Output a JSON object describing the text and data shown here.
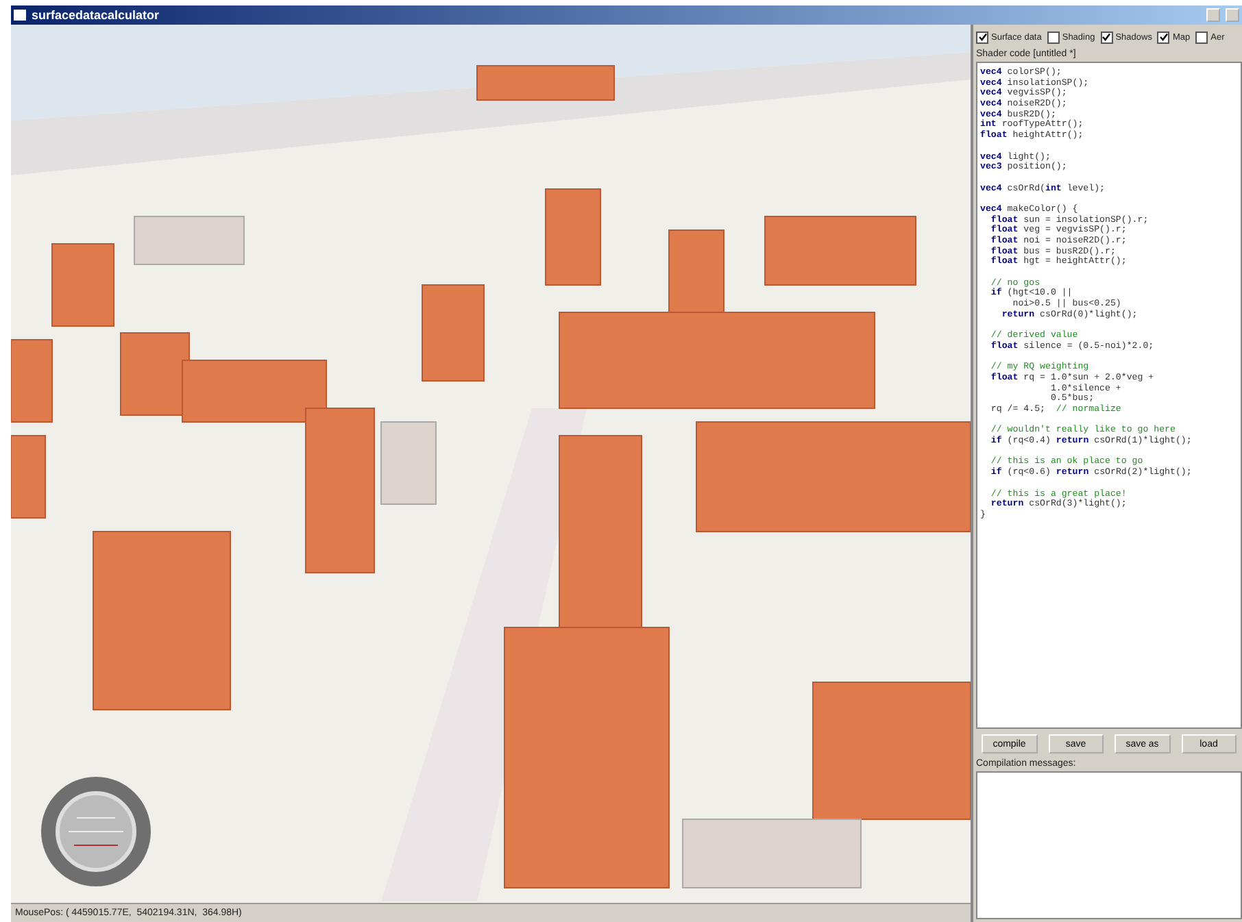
{
  "window": {
    "title": "surfacedatacalculator"
  },
  "layers": [
    {
      "label": "Surface data",
      "checked": true
    },
    {
      "label": "Shading",
      "checked": false
    },
    {
      "label": "Shadows",
      "checked": true
    },
    {
      "label": "Map",
      "checked": true
    },
    {
      "label": "Aer",
      "checked": false
    }
  ],
  "shader_editor": {
    "title": "Shader code [untitled *]",
    "lines": [
      {
        "kind": "code",
        "segments": [
          {
            "kind": "keyword",
            "text": "vec4"
          },
          {
            "kind": "plain",
            "text": " colorSP();"
          }
        ]
      },
      {
        "kind": "code",
        "segments": [
          {
            "kind": "keyword",
            "text": "vec4"
          },
          {
            "kind": "plain",
            "text": " insolationSP();"
          }
        ]
      },
      {
        "kind": "code",
        "segments": [
          {
            "kind": "keyword",
            "text": "vec4"
          },
          {
            "kind": "plain",
            "text": " vegvisSP();"
          }
        ]
      },
      {
        "kind": "code",
        "segments": [
          {
            "kind": "keyword",
            "text": "vec4"
          },
          {
            "kind": "plain",
            "text": " noiseR2D();"
          }
        ]
      },
      {
        "kind": "code",
        "segments": [
          {
            "kind": "keyword",
            "text": "vec4"
          },
          {
            "kind": "plain",
            "text": " busR2D();"
          }
        ]
      },
      {
        "kind": "code",
        "segments": [
          {
            "kind": "keyword",
            "text": "int"
          },
          {
            "kind": "plain",
            "text": " roofTypeAttr();"
          }
        ]
      },
      {
        "kind": "code",
        "segments": [
          {
            "kind": "keyword",
            "text": "float"
          },
          {
            "kind": "plain",
            "text": " heightAttr();"
          }
        ]
      },
      {
        "kind": "blank"
      },
      {
        "kind": "code",
        "segments": [
          {
            "kind": "keyword",
            "text": "vec4"
          },
          {
            "kind": "plain",
            "text": " light();"
          }
        ]
      },
      {
        "kind": "code",
        "segments": [
          {
            "kind": "keyword",
            "text": "vec3"
          },
          {
            "kind": "plain",
            "text": " position();"
          }
        ]
      },
      {
        "kind": "blank"
      },
      {
        "kind": "code",
        "segments": [
          {
            "kind": "keyword",
            "text": "vec4"
          },
          {
            "kind": "plain",
            "text": " csOrRd("
          },
          {
            "kind": "keyword",
            "text": "int"
          },
          {
            "kind": "plain",
            "text": " level);"
          }
        ]
      },
      {
        "kind": "blank"
      },
      {
        "kind": "code",
        "segments": [
          {
            "kind": "keyword",
            "text": "vec4"
          },
          {
            "kind": "plain",
            "text": " makeColor() {"
          }
        ]
      },
      {
        "kind": "code",
        "segments": [
          {
            "kind": "keyword",
            "text": "  float"
          },
          {
            "kind": "plain",
            "text": " sun = insolationSP().r;"
          }
        ]
      },
      {
        "kind": "code",
        "segments": [
          {
            "kind": "keyword",
            "text": "  float"
          },
          {
            "kind": "plain",
            "text": " veg = vegvisSP().r;"
          }
        ]
      },
      {
        "kind": "code",
        "segments": [
          {
            "kind": "keyword",
            "text": "  float"
          },
          {
            "kind": "plain",
            "text": " noi = noiseR2D().r;"
          }
        ]
      },
      {
        "kind": "code",
        "segments": [
          {
            "kind": "keyword",
            "text": "  float"
          },
          {
            "kind": "plain",
            "text": " bus = busR2D().r;"
          }
        ]
      },
      {
        "kind": "code",
        "segments": [
          {
            "kind": "keyword",
            "text": "  float"
          },
          {
            "kind": "plain",
            "text": " hgt = heightAttr();"
          }
        ]
      },
      {
        "kind": "blank"
      },
      {
        "kind": "code",
        "segments": [
          {
            "kind": "comment",
            "text": "  // no gos"
          }
        ]
      },
      {
        "kind": "code",
        "segments": [
          {
            "kind": "keyword",
            "text": "  if"
          },
          {
            "kind": "plain",
            "text": " (hgt<10.0 ||"
          }
        ]
      },
      {
        "kind": "code",
        "segments": [
          {
            "kind": "plain",
            "text": "      noi>0.5 || bus<0.25)"
          }
        ]
      },
      {
        "kind": "code",
        "segments": [
          {
            "kind": "keyword",
            "text": "    return"
          },
          {
            "kind": "plain",
            "text": " csOrRd(0)*light();"
          }
        ]
      },
      {
        "kind": "blank"
      },
      {
        "kind": "code",
        "segments": [
          {
            "kind": "comment",
            "text": "  // derived value"
          }
        ]
      },
      {
        "kind": "code",
        "segments": [
          {
            "kind": "keyword",
            "text": "  float"
          },
          {
            "kind": "plain",
            "text": " silence = (0.5-noi)*2.0;"
          }
        ]
      },
      {
        "kind": "blank"
      },
      {
        "kind": "code",
        "segments": [
          {
            "kind": "comment",
            "text": "  // my RQ weighting"
          }
        ]
      },
      {
        "kind": "code",
        "segments": [
          {
            "kind": "keyword",
            "text": "  float"
          },
          {
            "kind": "plain",
            "text": " rq = 1.0*sun + 2.0*veg +"
          }
        ]
      },
      {
        "kind": "code",
        "segments": [
          {
            "kind": "plain",
            "text": "             1.0*silence +"
          }
        ]
      },
      {
        "kind": "code",
        "segments": [
          {
            "kind": "plain",
            "text": "             0.5*bus;"
          }
        ]
      },
      {
        "kind": "code",
        "segments": [
          {
            "kind": "plain",
            "text": "  rq /= 4.5;  "
          },
          {
            "kind": "comment",
            "text": "// normalize"
          }
        ]
      },
      {
        "kind": "blank"
      },
      {
        "kind": "code",
        "segments": [
          {
            "kind": "comment",
            "text": "  // wouldn't really like to go here"
          }
        ]
      },
      {
        "kind": "code",
        "segments": [
          {
            "kind": "keyword",
            "text": "  if"
          },
          {
            "kind": "plain",
            "text": " (rq<0.4) "
          },
          {
            "kind": "keyword",
            "text": "return"
          },
          {
            "kind": "plain",
            "text": " csOrRd(1)*light();"
          }
        ]
      },
      {
        "kind": "blank"
      },
      {
        "kind": "code",
        "segments": [
          {
            "kind": "comment",
            "text": "  // this is an ok place to go"
          }
        ]
      },
      {
        "kind": "code",
        "segments": [
          {
            "kind": "keyword",
            "text": "  if"
          },
          {
            "kind": "plain",
            "text": " (rq<0.6) "
          },
          {
            "kind": "keyword",
            "text": "return"
          },
          {
            "kind": "plain",
            "text": " csOrRd(2)*light();"
          }
        ]
      },
      {
        "kind": "blank"
      },
      {
        "kind": "code",
        "segments": [
          {
            "kind": "comment",
            "text": "  // this is a great place!"
          }
        ]
      },
      {
        "kind": "code",
        "segments": [
          {
            "kind": "keyword",
            "text": "  return"
          },
          {
            "kind": "plain",
            "text": " csOrRd(3)*light();"
          }
        ]
      },
      {
        "kind": "code",
        "segments": [
          {
            "kind": "plain",
            "text": "}"
          }
        ]
      }
    ]
  },
  "buttons": [
    "compile",
    "save",
    "save as",
    "load"
  ],
  "messages": {
    "label": "Compilation messages:"
  },
  "status_bar": {
    "text": "MousePos: ( 4459015.77E,  5402194.31N,  364.98H)"
  }
}
